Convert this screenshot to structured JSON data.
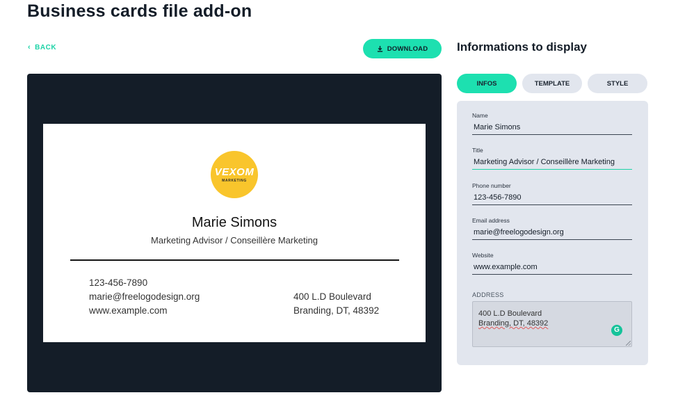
{
  "page": {
    "title": "Business cards file add-on"
  },
  "toolbar": {
    "back_label": "BACK",
    "download_label": "DOWNLOAD"
  },
  "card": {
    "logo_text": "VEXOM",
    "logo_subtext": "MARKETING",
    "name": "Marie Simons",
    "title": "Marketing Advisor / Conseillère Marketing",
    "phone": "123-456-7890",
    "email": "marie@freelogodesign.org",
    "website": "www.example.com",
    "address_line1": "400 L.D Boulevard",
    "address_line2": "Branding, DT, 48392",
    "logo_color": "#f9c52c"
  },
  "sidebar": {
    "heading": "Informations to display",
    "tabs": [
      {
        "label": "INFOS",
        "active": true
      },
      {
        "label": "TEMPLATE",
        "active": false
      },
      {
        "label": "STYLE",
        "active": false
      }
    ],
    "fields": {
      "name": {
        "label": "Name",
        "value": "Marie Simons"
      },
      "title": {
        "label": "Title",
        "value": "Marketing Advisor / Conseillère Marketing"
      },
      "phone": {
        "label": "Phone number",
        "value": "123-456-7890"
      },
      "email": {
        "label": "Email address",
        "value": "marie@freelogodesign.org"
      },
      "website": {
        "label": "Website",
        "value": "www.example.com"
      }
    },
    "address": {
      "label": "ADDRESS",
      "line1": "400 L.D Boulevard",
      "line2": "Branding, DT, 48392"
    }
  },
  "colors": {
    "accent": "#1de0b0",
    "panel_dark": "#141d28",
    "panel_light": "#e2e6ee"
  },
  "icons": {
    "back": "chevron-left-icon",
    "download": "download-icon",
    "grammar": "grammarly-icon"
  }
}
